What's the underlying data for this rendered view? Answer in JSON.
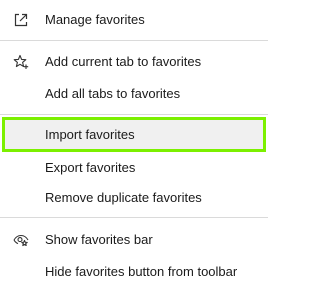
{
  "menu": {
    "items": [
      {
        "label": "Manage favorites",
        "icon": "external-link-icon"
      },
      {
        "label": "Add current tab to favorites",
        "icon": "star-add-icon"
      },
      {
        "label": "Add all tabs to favorites"
      },
      {
        "label": "Import favorites",
        "highlighted": true
      },
      {
        "label": "Export favorites"
      },
      {
        "label": "Remove duplicate favorites"
      },
      {
        "label": "Show favorites bar",
        "icon": "eye-star-icon"
      },
      {
        "label": "Hide favorites button from toolbar"
      }
    ]
  },
  "colors": {
    "highlight_border": "#7cf000",
    "highlight_background": "#f0f0f0",
    "divider": "#dadada",
    "text": "#1a1a1a"
  }
}
